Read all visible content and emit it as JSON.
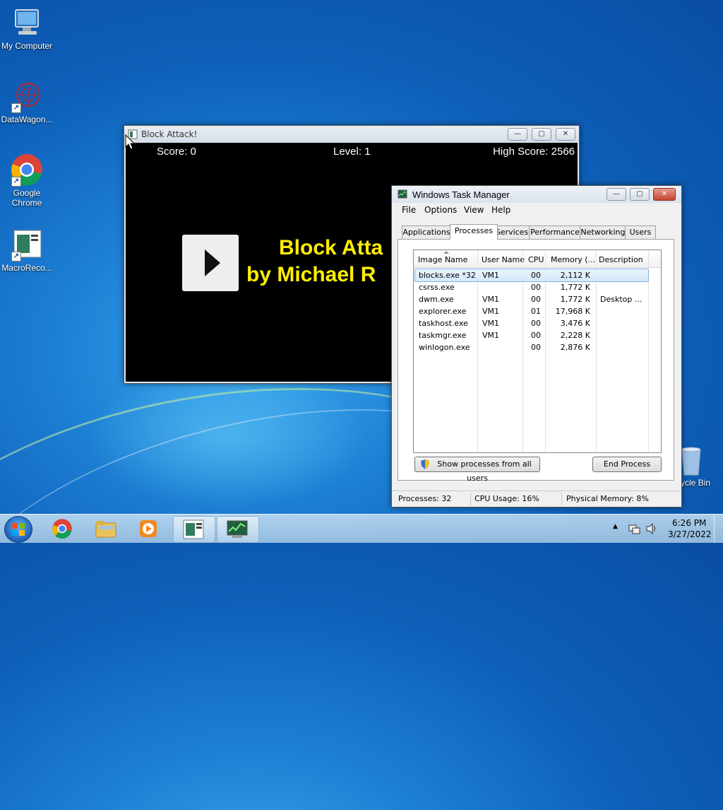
{
  "desktop": {
    "icons": [
      {
        "label": "My Computer",
        "icon": "computer-icon"
      },
      {
        "label": "DataWagon...",
        "icon": "datawagon-icon"
      },
      {
        "label": "Google Chrome",
        "icon": "chrome-icon"
      },
      {
        "label": "MacroReco...",
        "icon": "macro-recorder-icon"
      },
      {
        "label": "ycle Bin",
        "icon": "recycle-bin-icon"
      }
    ]
  },
  "game_window": {
    "title": "Block Attack!",
    "score": "Score: 0",
    "level": "Level: 1",
    "high_score": "High Score: 2566",
    "title_line1": "Block Atta",
    "title_line2": "by Michael R",
    "buttons": {
      "minimize": "—",
      "maximize": "▢",
      "close": "✕"
    }
  },
  "task_manager": {
    "title": "Windows Task Manager",
    "menu": [
      "File",
      "Options",
      "View",
      "Help"
    ],
    "tabs": [
      "Applications",
      "Processes",
      "Services",
      "Performance",
      "Networking",
      "Users"
    ],
    "active_tab": "Processes",
    "columns": [
      "Image Name",
      "User Name",
      "CPU",
      "Memory (...",
      "Description"
    ],
    "rows": [
      {
        "image": "blocks.exe *32",
        "user": "VM1",
        "cpu": "00",
        "memory": "2,112 K",
        "description": ""
      },
      {
        "image": "csrss.exe",
        "user": "",
        "cpu": "00",
        "memory": "1,772 K",
        "description": ""
      },
      {
        "image": "dwm.exe",
        "user": "VM1",
        "cpu": "00",
        "memory": "1,772 K",
        "description": "Desktop ..."
      },
      {
        "image": "explorer.exe",
        "user": "VM1",
        "cpu": "01",
        "memory": "17,968 K",
        "description": ""
      },
      {
        "image": "taskhost.exe",
        "user": "VM1",
        "cpu": "00",
        "memory": "3,476 K",
        "description": ""
      },
      {
        "image": "taskmgr.exe",
        "user": "VM1",
        "cpu": "00",
        "memory": "2,228 K",
        "description": ""
      },
      {
        "image": "winlogon.exe",
        "user": "",
        "cpu": "00",
        "memory": "2,876 K",
        "description": ""
      }
    ],
    "show_all_label": "Show processes from all users",
    "end_process_label": "End Process",
    "status": {
      "processes": "Processes: 32",
      "cpu": "CPU Usage: 16%",
      "memory": "Physical Memory: 8%"
    }
  },
  "taskbar": {
    "time": "6:26 PM",
    "date": "3/27/2022"
  }
}
